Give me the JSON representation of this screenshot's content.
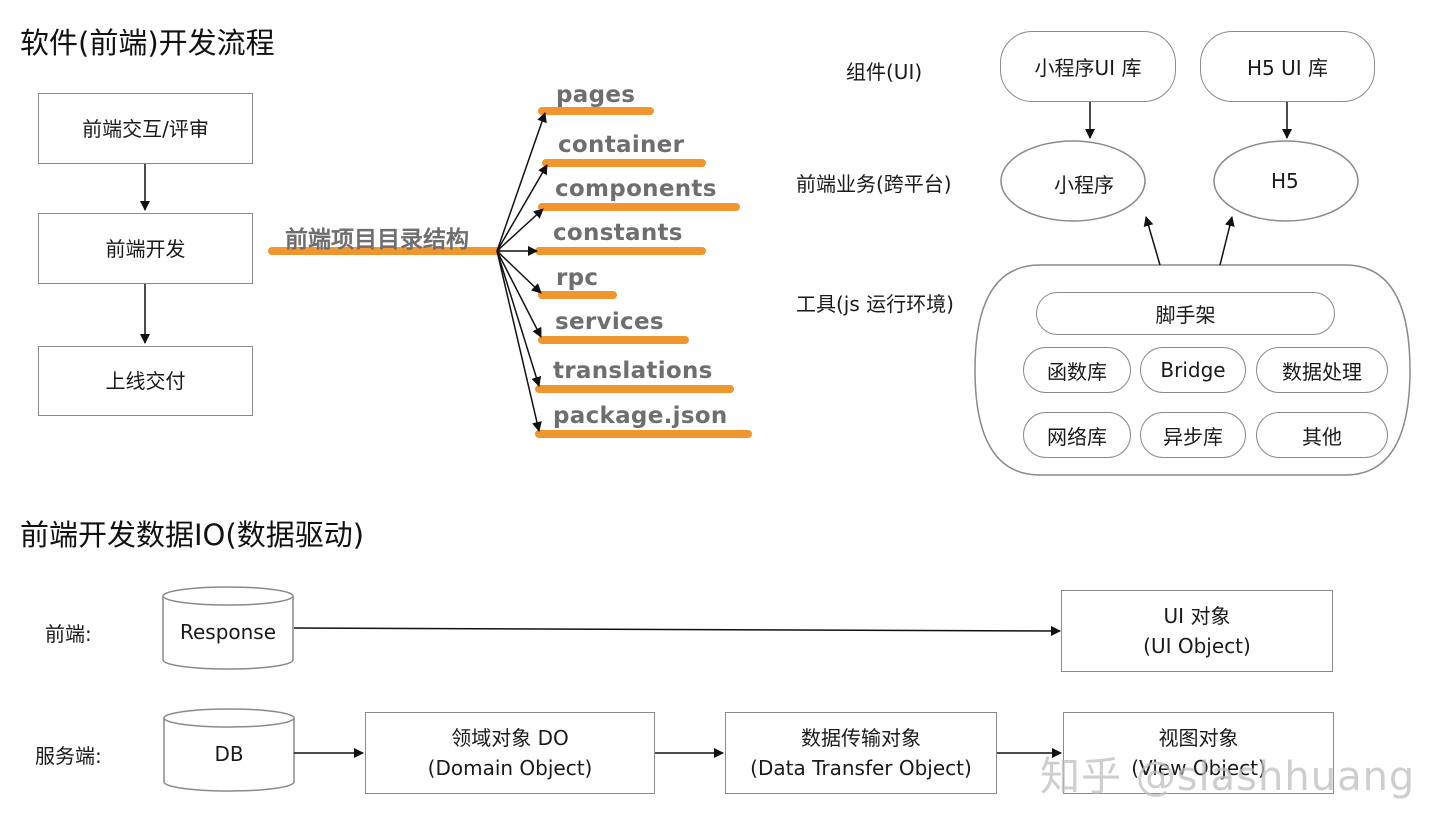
{
  "section1": {
    "title": "软件(前端)开发流程",
    "flow": [
      "前端交互/评审",
      "前端开发",
      "上线交付"
    ],
    "directory": {
      "root": "前端项目目录结构",
      "items": [
        "pages",
        "container",
        "components",
        "constants",
        "rpc",
        "services",
        "translations",
        "package.json"
      ],
      "accent_color": "#F0962E"
    }
  },
  "architecture": {
    "rows": {
      "components": "组件(UI)",
      "business": "前端业务(跨平台)",
      "tools": "工具(js 运行环境)"
    },
    "ui_libs": [
      "小程序UI 库",
      "H5 UI 库"
    ],
    "platforms": [
      "小程序",
      "H5"
    ],
    "scaffold": "脚手架",
    "tool_items": [
      "函数库",
      "Bridge",
      "数据处理",
      "网络库",
      "异步库",
      "其他"
    ]
  },
  "section2": {
    "title": "前端开发数据IO(数据驱动)",
    "frontend_label": "前端:",
    "server_label": "服务端:",
    "response": "Response",
    "db": "DB",
    "ui_object": {
      "line1": "UI 对象",
      "line2": "(UI Object)"
    },
    "domain_object": {
      "line1": "领域对象 DO",
      "line2": "(Domain Object)"
    },
    "dto": {
      "line1": "数据传输对象",
      "line2": "(Data Transfer Object)"
    },
    "view_object": {
      "line1": "视图对象",
      "line2": "(View Object)"
    }
  },
  "watermark": "知乎 @slashhuang"
}
